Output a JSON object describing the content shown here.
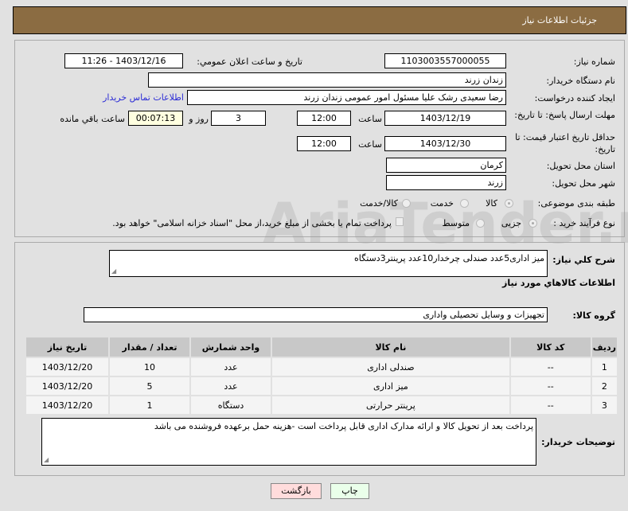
{
  "header": {
    "title": "جزئيات اطلاعات نياز"
  },
  "form": {
    "need_number_label": "شماره نیاز:",
    "need_number": "1103003557000055",
    "announce_label": "تاريخ و ساعت اعلان عمومي:",
    "announce_value": "1403/12/16 - 11:26",
    "buyer_org_label": "نام دستگاه خریدار:",
    "buyer_org": "زندان زرند",
    "creator_label": "ایجاد کننده درخواست:",
    "creator": "رضا سعیدی رشک علیا مسئول امور عمومی زندان زرند",
    "contact_link": "اطلاعات تماس خریدار",
    "deadline_label": "مهلت ارسال پاسخ: تا تاریخ:",
    "deadline_date": "1403/12/19",
    "time_label": "ساعت",
    "deadline_time": "12:00",
    "days": "3",
    "days_label": "روز و",
    "remaining": "00:07:13",
    "remaining_label": "ساعت باقي مانده",
    "validity_label": "حداقل تاریخ اعتبار قیمت: تا تاریخ:",
    "validity_date": "1403/12/30",
    "validity_time": "12:00",
    "province_label": "استان محل تحویل:",
    "province": "کرمان",
    "city_label": "شهر محل تحویل:",
    "city": "زرند",
    "category_label": "طبقه بندی موضوعی:",
    "category_options": [
      "کالا",
      "خدمت",
      "کالا/خدمت"
    ],
    "process_label": "نوع فرآیند خرید :",
    "process_options": [
      "جزیی",
      "متوسط"
    ],
    "payment_note": "پرداخت تمام یا بخشی از مبلغ خرید،از محل \"اسناد خزانه اسلامی\" خواهد بود."
  },
  "details": {
    "desc_label": "شرح کلي نياز:",
    "desc": "میز اداری5عدد صندلی چرخدار10عدد پرینتر3دستگاه",
    "goods_title": "اطلاعات کالاهاي مورد نياز",
    "group_label": "گروه کالا:",
    "group": "تجهیزات و وسایل تحصیلی واداری",
    "columns": [
      "رديف",
      "كد كالا",
      "نام كالا",
      "واحد شمارش",
      "تعداد / مقدار",
      "تاريخ نياز"
    ],
    "rows": [
      [
        "1",
        "--",
        "صندلی اداری",
        "عدد",
        "10",
        "1403/12/20"
      ],
      [
        "2",
        "--",
        "میز اداری",
        "عدد",
        "5",
        "1403/12/20"
      ],
      [
        "3",
        "--",
        "پرینتر حرارتی",
        "دستگاه",
        "1",
        "1403/12/20"
      ]
    ],
    "buyer_notes_label": "توضیحات خریدار:",
    "buyer_notes": "پرداخت بعد از تحویل کالا و ارائه مدارک اداری قابل پرداخت است -هزینه حمل برعهده فروشنده می باشد"
  },
  "buttons": {
    "print": "چاپ",
    "back": "بازگشت"
  },
  "watermark": "AriaTender.neT"
}
